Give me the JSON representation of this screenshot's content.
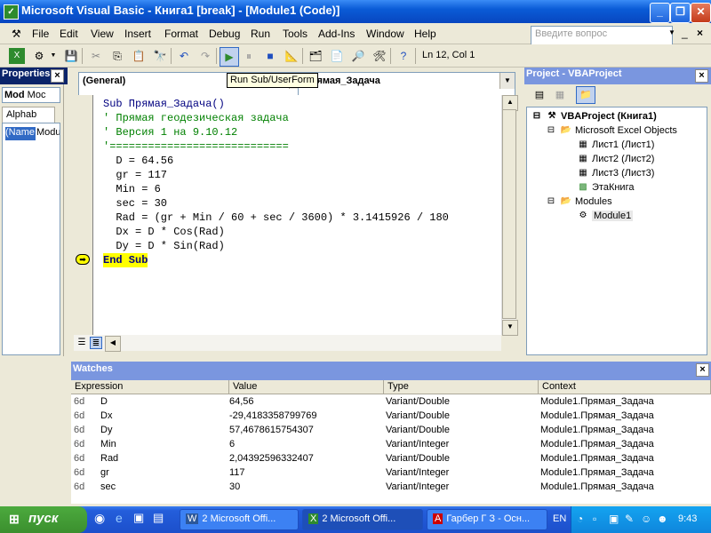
{
  "window": {
    "title": "Microsoft Visual Basic - Книга1 [break] - [Module1 (Code)]"
  },
  "menu": {
    "items": [
      "File",
      "Edit",
      "View",
      "Insert",
      "Format",
      "Debug",
      "Run",
      "Tools",
      "Add-Ins",
      "Window",
      "Help"
    ],
    "question_placeholder": "Введите вопрос"
  },
  "toolbar": {
    "position": "Ln 12, Col 1",
    "tooltip": "Run Sub/UserForm"
  },
  "properties": {
    "title": "Properties",
    "combo_value": "Mod",
    "combo_value2": "Moc",
    "tab_alpha": "Alphab",
    "row_name": "(Name",
    "row_value": "Modu"
  },
  "code": {
    "object_combo": "(General)",
    "proc_combo": "Прямая_Задача",
    "lines": [
      {
        "text": "Sub Прямая_Задача()",
        "kind": "kw"
      },
      {
        "text": "' Прямая геодезическая задача",
        "kind": "cm"
      },
      {
        "text": "' Версия 1 на 9.10.12",
        "kind": "cm"
      },
      {
        "text": "'============================",
        "kind": "cm"
      },
      {
        "text": "  D = 64.56",
        "kind": "plain"
      },
      {
        "text": "  gr = 117",
        "kind": "plain"
      },
      {
        "text": "  Min = 6",
        "kind": "plain"
      },
      {
        "text": "  sec = 30",
        "kind": "plain"
      },
      {
        "text": "  Rad = (gr + Min / 60 + sec / 3600) * 3.1415926 / 180",
        "kind": "plain"
      },
      {
        "text": "  Dx = D * Cos(Rad)",
        "kind": "plain"
      },
      {
        "text": "  Dy = D * Sin(Rad)",
        "kind": "plain"
      },
      {
        "text": "End Sub",
        "kind": "exec"
      }
    ]
  },
  "project": {
    "title": "Project - VBAProject",
    "root": "VBAProject (Книга1)",
    "excel_objects": "Microsoft Excel Objects",
    "sheets": [
      "Лист1 (Лист1)",
      "Лист2 (Лист2)",
      "Лист3 (Лист3)"
    ],
    "workbook": "ЭтаКнига",
    "modules_folder": "Modules",
    "module": "Module1"
  },
  "watches": {
    "title": "Watches",
    "columns": [
      "Expression",
      "Value",
      "Type",
      "Context"
    ],
    "rows": [
      {
        "expr": "D",
        "value": "64,56",
        "type": "Variant/Double",
        "context": "Module1.Прямая_Задача"
      },
      {
        "expr": "Dx",
        "value": "-29,4183358799769",
        "type": "Variant/Double",
        "context": "Module1.Прямая_Задача"
      },
      {
        "expr": "Dy",
        "value": "57,4678615754307",
        "type": "Variant/Double",
        "context": "Module1.Прямая_Задача"
      },
      {
        "expr": "Min",
        "value": "6",
        "type": "Variant/Integer",
        "context": "Module1.Прямая_Задача"
      },
      {
        "expr": "Rad",
        "value": "2,04392596332407",
        "type": "Variant/Double",
        "context": "Module1.Прямая_Задача"
      },
      {
        "expr": "gr",
        "value": "117",
        "type": "Variant/Integer",
        "context": "Module1.Прямая_Задача"
      },
      {
        "expr": "sec",
        "value": "30",
        "type": "Variant/Integer",
        "context": "Module1.Прямая_Задача"
      }
    ],
    "glasses": "6d"
  },
  "taskbar": {
    "start": "пуск",
    "tasks": [
      "2 Microsoft Offi...",
      "2 Microsoft Offi...",
      "Гарбер Г З - Осн..."
    ],
    "lang": "EN",
    "clock": "9:43"
  }
}
